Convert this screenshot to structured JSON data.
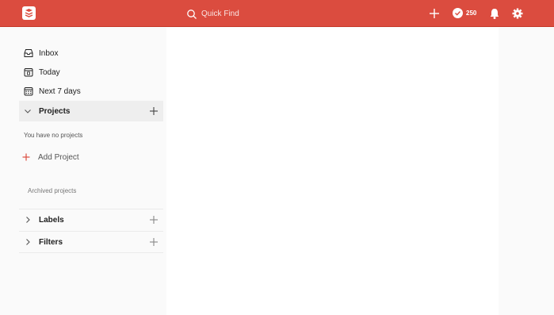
{
  "topbar": {
    "search_placeholder": "Quick Find",
    "karma_points": "250",
    "accent_color": "#db4c3f",
    "icons": [
      "logo-icon",
      "search-icon",
      "add-task-icon",
      "karma-check-icon",
      "bell-icon",
      "gear-icon"
    ]
  },
  "sidebar": {
    "nav": [
      {
        "label": "Inbox",
        "icon": "inbox-icon"
      },
      {
        "label": "Today",
        "icon": "calendar-today-icon"
      },
      {
        "label": "Next 7 days",
        "icon": "calendar-week-icon"
      }
    ],
    "projects": {
      "title": "Projects",
      "empty_text": "You have no projects",
      "add_label": "Add Project",
      "archived_label": "Archived projects"
    },
    "labels": {
      "title": "Labels"
    },
    "filters": {
      "title": "Filters"
    }
  }
}
